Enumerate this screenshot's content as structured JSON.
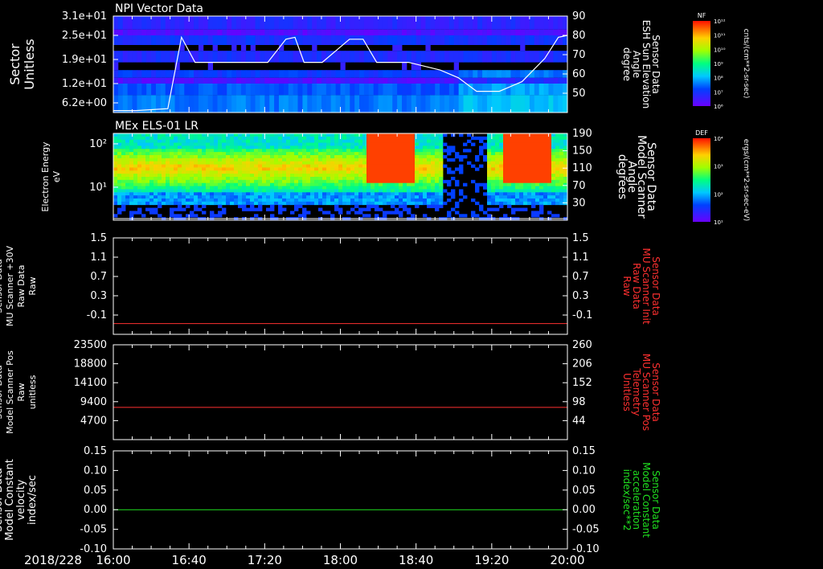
{
  "date_label": "2018/228",
  "time_ticks": [
    "16:00",
    "16:40",
    "17:20",
    "18:00",
    "18:40",
    "19:20",
    "20:00"
  ],
  "colors": {
    "red": "#ff3030",
    "green": "#20e020",
    "white": "#ffffff"
  },
  "panels": [
    {
      "title": "NPI Vector Data",
      "left_label": [
        "Sector",
        "Unitless"
      ],
      "left_ticks": [
        "3.1e+01",
        "2.5e+01",
        "1.9e+01",
        "1.2e+01",
        "6.2e+00"
      ],
      "right_label": [
        "Sensor Data",
        "ESH Sun Elevation",
        "Angle",
        "degree"
      ],
      "right_ticks": [
        "90",
        "80",
        "70",
        "60",
        "50"
      ],
      "colorbar_tag": "NF",
      "colorbar_ticks": [
        "10¹²",
        "10¹¹",
        "10¹⁰",
        "10⁹",
        "10⁸",
        "10⁷",
        "10⁶"
      ],
      "colorbar_unit": "cnts/(cm**2-sr-sec)"
    },
    {
      "title": "MEx ELS-01 LR",
      "left_label": [
        "Electron Energy",
        "eV"
      ],
      "left_ticks": [
        "10²",
        "10¹"
      ],
      "right_label": [
        "Sensor Data",
        "Model Scanner",
        "Angle",
        "degrees"
      ],
      "right_ticks": [
        "190",
        "150",
        "110",
        "70",
        "30"
      ],
      "colorbar_tag": "DEF",
      "colorbar_ticks": [
        "10⁴",
        "10³",
        "10²",
        "10¹"
      ],
      "colorbar_unit": "ergs/(cm**2-sr-sec-eV)"
    },
    {
      "title": "",
      "left_label": [
        "Sensor Data",
        "MU Scanner +30V",
        "Raw Data",
        "Raw"
      ],
      "left_ticks": [
        "1.5",
        "1.1",
        "0.7",
        "0.3",
        "-0.1"
      ],
      "right_label": [
        "Sensor Data",
        "MU Scanner Init",
        "Raw Data",
        "Raw"
      ],
      "right_ticks": [
        "1.5",
        "1.1",
        "0.7",
        "0.3",
        "-0.1"
      ]
    },
    {
      "title": "",
      "left_label": [
        "Sensor Data",
        "Model Scanner Pos",
        "Raw",
        "unitless"
      ],
      "left_ticks": [
        "23500",
        "18800",
        "14100",
        "9400",
        "4700"
      ],
      "right_label": [
        "Sensor Data",
        "MU Scanner Pos",
        "Telemetry",
        "Unitless"
      ],
      "right_ticks": [
        "260",
        "206",
        "152",
        "98",
        "44"
      ]
    },
    {
      "title": "",
      "left_label": [
        "Sensor Data",
        "Model Constant",
        "velocity",
        "index/sec"
      ],
      "left_ticks": [
        "0.15",
        "0.10",
        "0.05",
        "0.00",
        "-0.05",
        "-0.10"
      ],
      "right_label": [
        "Sensor Data",
        "Model Constant",
        "acceleration",
        "index/sec**2"
      ],
      "right_ticks": [
        "0.15",
        "0.10",
        "0.05",
        "0.00",
        "-0.05",
        "-0.10"
      ]
    }
  ],
  "chart_data": [
    {
      "type": "heatmap",
      "title": "NPI Vector Data",
      "x_range": [
        "16:00",
        "20:00"
      ],
      "ylabel": "Sector Unitless",
      "series": [
        {
          "name": "Sensor Data ESH Sun Elevation Angle",
          "x": [
            0,
            5,
            12,
            15,
            18,
            22,
            28,
            34,
            38,
            40,
            42,
            46,
            52,
            55,
            58,
            65,
            72,
            76,
            80,
            82,
            85,
            90,
            95,
            98,
            100
          ],
          "y": [
            41,
            41,
            42,
            79,
            66,
            66,
            66,
            66,
            78,
            79,
            66,
            66,
            78,
            78,
            66,
            66,
            62,
            58,
            51,
            51,
            51,
            56,
            68,
            79,
            80
          ]
        }
      ]
    },
    {
      "type": "heatmap",
      "title": "MEx ELS-01 LR",
      "ylabel": "Electron Energy eV",
      "series": [
        {
          "name": "Sensor Data Model Scanner Angle",
          "y_const": 20
        }
      ]
    },
    {
      "type": "line",
      "ylim": [
        -0.3,
        1.5
      ],
      "series": [
        {
          "name": "Sensor Data MU Scanner Init Raw Data",
          "constant": -0.1
        }
      ]
    },
    {
      "type": "line",
      "ylim": [
        0,
        23500
      ],
      "series": [
        {
          "name": "Sensor Data MU Scanner Pos Telemetry",
          "constant": 8000
        }
      ]
    },
    {
      "type": "line",
      "ylim": [
        -0.1,
        0.15
      ],
      "series": [
        {
          "name": "Sensor Data Model Constant velocity",
          "constant": 0.0
        }
      ]
    }
  ]
}
